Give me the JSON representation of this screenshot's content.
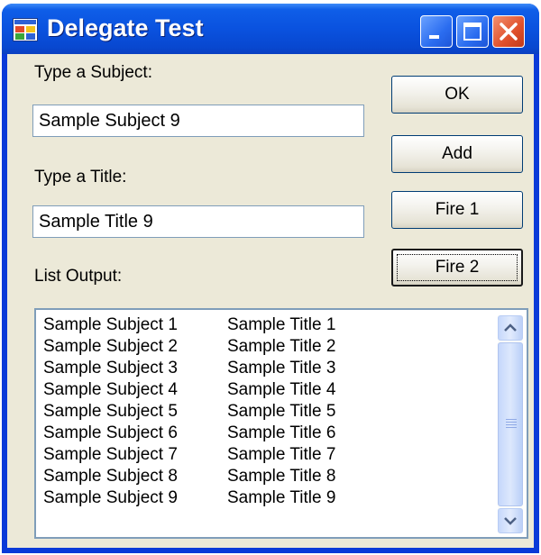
{
  "window": {
    "title": "Delegate Test",
    "icon": "windows-form-icon"
  },
  "caption_buttons": {
    "minimize_icon": "minimize-icon",
    "maximize_icon": "maximize-icon",
    "close_icon": "close-icon"
  },
  "form": {
    "subject_label": "Type a Subject:",
    "subject_value": "Sample Subject 9",
    "title_label": "Type a Title:",
    "title_value": "Sample Title 9",
    "output_label": "List Output:"
  },
  "buttons": {
    "ok": "OK",
    "add": "Add",
    "fire1": "Fire 1",
    "fire2": "Fire 2"
  },
  "list": {
    "rows": [
      {
        "subject": "Sample Subject 1",
        "title": "Sample Title 1"
      },
      {
        "subject": "Sample Subject 2",
        "title": "Sample Title 2"
      },
      {
        "subject": "Sample Subject 3",
        "title": "Sample Title 3"
      },
      {
        "subject": "Sample Subject 4",
        "title": "Sample Title 4"
      },
      {
        "subject": "Sample Subject 5",
        "title": "Sample Title 5"
      },
      {
        "subject": "Sample Subject 6",
        "title": "Sample Title 6"
      },
      {
        "subject": "Sample Subject 7",
        "title": "Sample Title 7"
      },
      {
        "subject": "Sample Subject 8",
        "title": "Sample Title 8"
      },
      {
        "subject": "Sample Subject 9",
        "title": "Sample Title 9"
      }
    ]
  },
  "colors": {
    "titlebar": "#0a52df",
    "client_background": "#ece9d8",
    "close_button": "#e0502b",
    "scrollbar": "#c6d8fb"
  }
}
